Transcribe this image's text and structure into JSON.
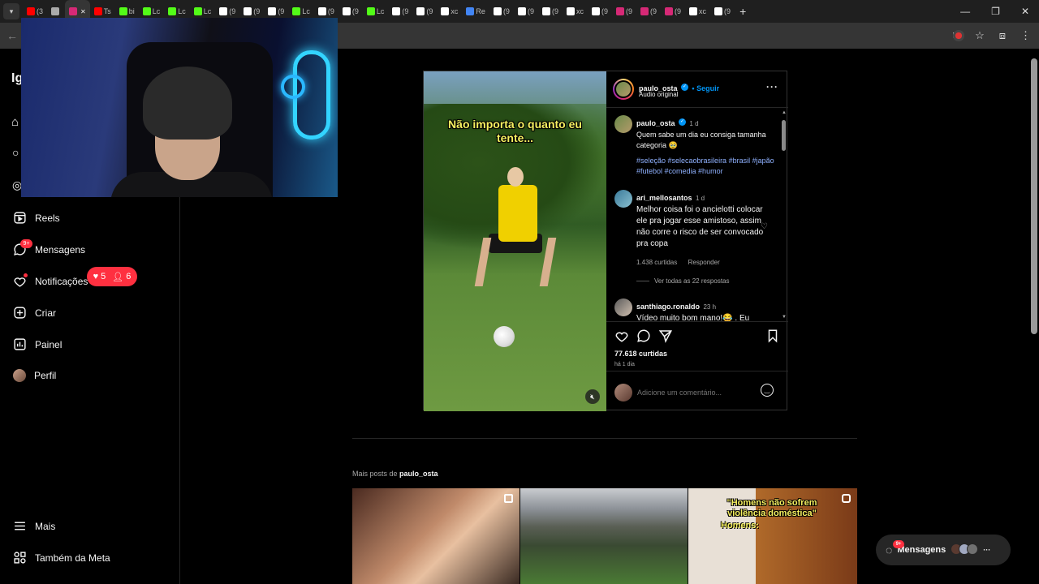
{
  "browser": {
    "tabs": [
      {
        "label": "(3",
        "icon": "youtube-icon",
        "color": "#ff0000"
      },
      {
        "label": "",
        "icon": "loading-icon",
        "color": "#aaaaaa"
      },
      {
        "label": "",
        "icon": "instagram-icon",
        "color": "#d62976",
        "active": true
      },
      {
        "label": "Ts",
        "icon": "youtube-icon",
        "color": "#ff0000"
      },
      {
        "label": "bi",
        "icon": "kick-icon",
        "color": "#53fc18"
      },
      {
        "label": "Lc",
        "icon": "kick-icon",
        "color": "#53fc18"
      },
      {
        "label": "Lc",
        "icon": "kick-icon",
        "color": "#53fc18"
      },
      {
        "label": "Lc",
        "icon": "kick-icon",
        "color": "#53fc18"
      },
      {
        "label": "(9",
        "icon": "tiktok-icon",
        "color": "#ffffff"
      },
      {
        "label": "(9",
        "icon": "tiktok-icon",
        "color": "#ffffff"
      },
      {
        "label": "(9",
        "icon": "tiktok-icon",
        "color": "#ffffff"
      },
      {
        "label": "Lc",
        "icon": "kick-icon",
        "color": "#53fc18"
      },
      {
        "label": "(9",
        "icon": "tiktok-icon",
        "color": "#ffffff"
      },
      {
        "label": "(9",
        "icon": "tiktok-icon",
        "color": "#ffffff"
      },
      {
        "label": "Lc",
        "icon": "kick-icon",
        "color": "#53fc18"
      },
      {
        "label": "(9",
        "icon": "tiktok-icon",
        "color": "#ffffff"
      },
      {
        "label": "(9",
        "icon": "tiktok-icon",
        "color": "#ffffff"
      },
      {
        "label": "xc",
        "icon": "x-icon",
        "color": "#ffffff"
      },
      {
        "label": "Re",
        "icon": "google-icon",
        "color": "#4285f4"
      },
      {
        "label": "(9",
        "icon": "tiktok-icon",
        "color": "#ffffff"
      },
      {
        "label": "(9",
        "icon": "tiktok-icon",
        "color": "#ffffff"
      },
      {
        "label": "(9",
        "icon": "tiktok-icon",
        "color": "#ffffff"
      },
      {
        "label": "xc",
        "icon": "x-icon",
        "color": "#ffffff"
      },
      {
        "label": "(9",
        "icon": "tiktok-icon",
        "color": "#ffffff"
      },
      {
        "label": "(9",
        "icon": "instagram-icon",
        "color": "#d62976"
      },
      {
        "label": "(9",
        "icon": "instagram-icon",
        "color": "#d62976"
      },
      {
        "label": "(9",
        "icon": "instagram-icon",
        "color": "#d62976"
      },
      {
        "label": "xc",
        "icon": "x-icon",
        "color": "#ffffff"
      },
      {
        "label": "(9",
        "icon": "tiktok-icon",
        "color": "#ffffff"
      }
    ],
    "new_tab": "+",
    "win_min": "—",
    "win_restore": "❐",
    "win_close": "✕",
    "back": "←"
  },
  "sidebar": {
    "reels": "Reels",
    "messages": "Mensagens",
    "messages_badge": "9+",
    "notifications": "Notificações",
    "notif_likes": "5",
    "notif_follows": "6",
    "create": "Criar",
    "dashboard": "Painel",
    "profile": "Perfil",
    "more": "Mais",
    "meta": "Também da Meta"
  },
  "post": {
    "video_caption": "Não importa o quanto eu tente...",
    "author": "paulo_osta",
    "follow": "Seguir",
    "audio": "Áudio original",
    "caption_author": "paulo_osta",
    "caption_time": "1 d",
    "caption_text": "Quem sabe um dia eu consiga tamanha categoria 🥹",
    "hashtags": "#seleção #selecaobrasileira #brasil #japão #futebol #comedia #humor",
    "comments": [
      {
        "user": "ari_mellosantos",
        "time": "1 d",
        "text": "Melhor coisa foi o ancielotti colocar ele pra jogar esse amistoso, assim não corre o risco de ser convocado pra copa",
        "likes": "1.438 curtidas",
        "reply": "Responder",
        "view_replies": "Ver todas as 22 respostas"
      },
      {
        "user": "santhiago.ronaldo",
        "time": "23 h",
        "text": "Vídeo muito bom mano!😂 . Eu"
      }
    ],
    "likes": "77.618 curtidas",
    "posted": "há 1 dia",
    "add_comment_placeholder": "Adicione um comentário..."
  },
  "more_posts": {
    "label_prefix": "Mais posts de",
    "user": "paulo_osta",
    "thumb3_caption": "\"Homens não sofrem violência doméstica\"",
    "thumb3_caption2": "Homens:"
  },
  "float_messages": {
    "label": "Mensagens",
    "badge": "9+"
  },
  "colors": {
    "accent_blue": "#0095f6",
    "badge_red": "#ff3040",
    "hashtag_blue": "#8fb1ff"
  }
}
